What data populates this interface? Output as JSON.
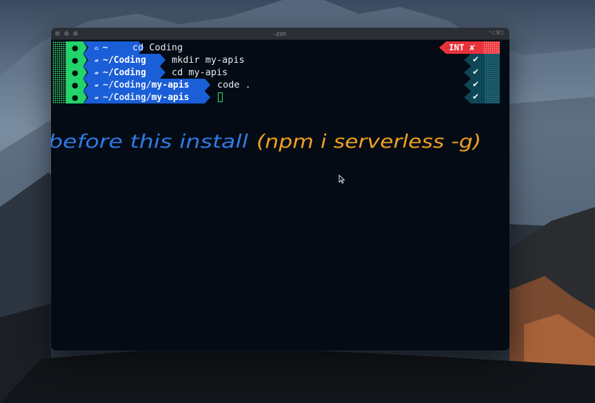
{
  "window": {
    "title": "-zsh",
    "shortcut": "⌥⌘1"
  },
  "prompt_lines": [
    {
      "path_prefix": "~",
      "path_bold": "",
      "home_icon": true,
      "command": "cd Coding",
      "status": "INT ✘"
    },
    {
      "path_prefix": "",
      "path_bold": "~/Coding",
      "home_icon": false,
      "command": "mkdir my-apis",
      "status": "✔"
    },
    {
      "path_prefix": "",
      "path_bold": "~/Coding",
      "home_icon": false,
      "command": "cd my-apis",
      "status": "✔"
    },
    {
      "path_prefix": "~/Coding/",
      "path_bold": "my-apis",
      "home_icon": false,
      "command": "code .",
      "status": "✔"
    },
    {
      "path_prefix": "~/Coding/",
      "path_bold": "my-apis",
      "home_icon": false,
      "command": "",
      "status": "✔"
    }
  ],
  "annotation": {
    "blue_text": "before this install",
    "orange_text": "(npm i serverless -g)",
    "blue_color": "#2f7ae6",
    "orange_color": "#f0a020"
  },
  "colors": {
    "segment_green": "#23d36b",
    "segment_blue": "#1a5ed8",
    "status_error": "#e8323a",
    "status_ok": "#0f4655",
    "terminal_bg": "#040b14"
  },
  "icons": [
    "apple-icon",
    "home-icon",
    "folder-icon",
    "check-icon",
    "mouse-pointer-icon"
  ]
}
